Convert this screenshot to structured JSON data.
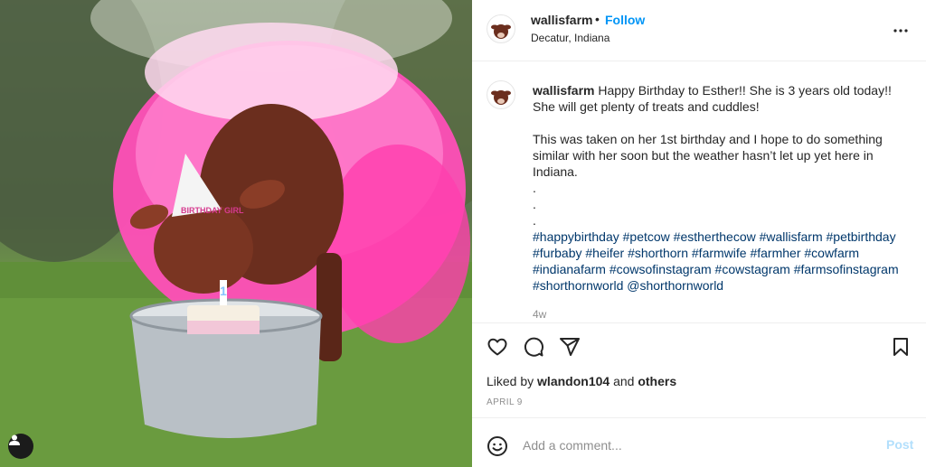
{
  "post": {
    "image_alt": "Calf in pink tutu and birthday hat with cake",
    "hat_text": "BIRTHDAY GIRL",
    "candle_number": "1"
  },
  "header": {
    "username": "wallisfarm",
    "separator": "•",
    "follow_label": "Follow",
    "location": "Decatur, Indiana"
  },
  "caption": {
    "username": "wallisfarm",
    "line1": "Happy Birthday to Esther!! She is 3 years old today!! She will get plenty of treats and cuddles!",
    "line2": "This was taken on her 1st birthday and I hope to do something similar with her soon but the weather hasn’t let up yet here in Indiana.",
    "dots": [
      ".",
      ".",
      "."
    ],
    "hashtags": "#happybirthday #petcow #estherthecow #wallisfarm #petbirthday #furbaby #heifer #shorthorn #farmwife #farmher #cowfarm #indianafarm #cowsofinstagram #cowstagram #farmsofinstagram #shorthornworld @shorthornworld",
    "time_ago": "4w"
  },
  "actions": {
    "liked_prefix": "Liked by",
    "liked_user": "wlandon104",
    "liked_and": "and",
    "liked_others": "others",
    "date": "APRIL 9"
  },
  "comment": {
    "placeholder": "Add a comment...",
    "post_label": "Post"
  },
  "icons": {
    "more": "more-horizontal-icon",
    "like": "heart-icon",
    "comment": "comment-bubble-icon",
    "share": "paper-plane-icon",
    "save": "bookmark-icon",
    "emoji": "smiley-icon",
    "user_tag": "user-tag-icon"
  },
  "colors": {
    "follow_blue": "#0095f6",
    "hashtag_blue": "#00376b",
    "post_disabled": "#b2dffc",
    "muted": "#8e8e8e"
  }
}
